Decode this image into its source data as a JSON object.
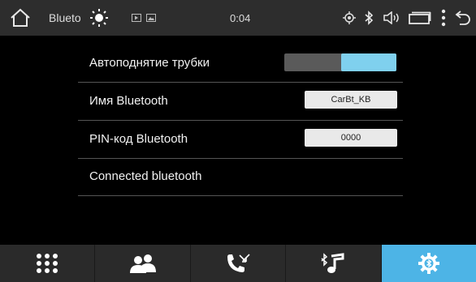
{
  "statusbar": {
    "title": "Blueto",
    "time": "0:04",
    "icons": [
      "home-icon",
      "brightness-icon",
      "video-icon",
      "photo-icon",
      "gps-icon",
      "bluetooth-icon",
      "volume-icon",
      "window-icon",
      "more-icon",
      "back-icon"
    ]
  },
  "settings": {
    "auto_answer_label": "Автоподнятие трубки",
    "auto_answer_state": "on",
    "bt_name_label": "Имя Bluetooth",
    "bt_name_value": "CarBt_KB",
    "pin_label": "PIN-код Bluetooth",
    "pin_value": "0000",
    "connected_label": "Connected bluetooth"
  },
  "navbar": {
    "items": [
      "keypad",
      "contacts",
      "call-log",
      "bluetooth-music",
      "bluetooth-settings"
    ],
    "active": "bluetooth-settings"
  },
  "colors": {
    "accent": "#4db4e6",
    "toggle_on": "#7fd0ee",
    "bar": "#2d2d2d"
  }
}
